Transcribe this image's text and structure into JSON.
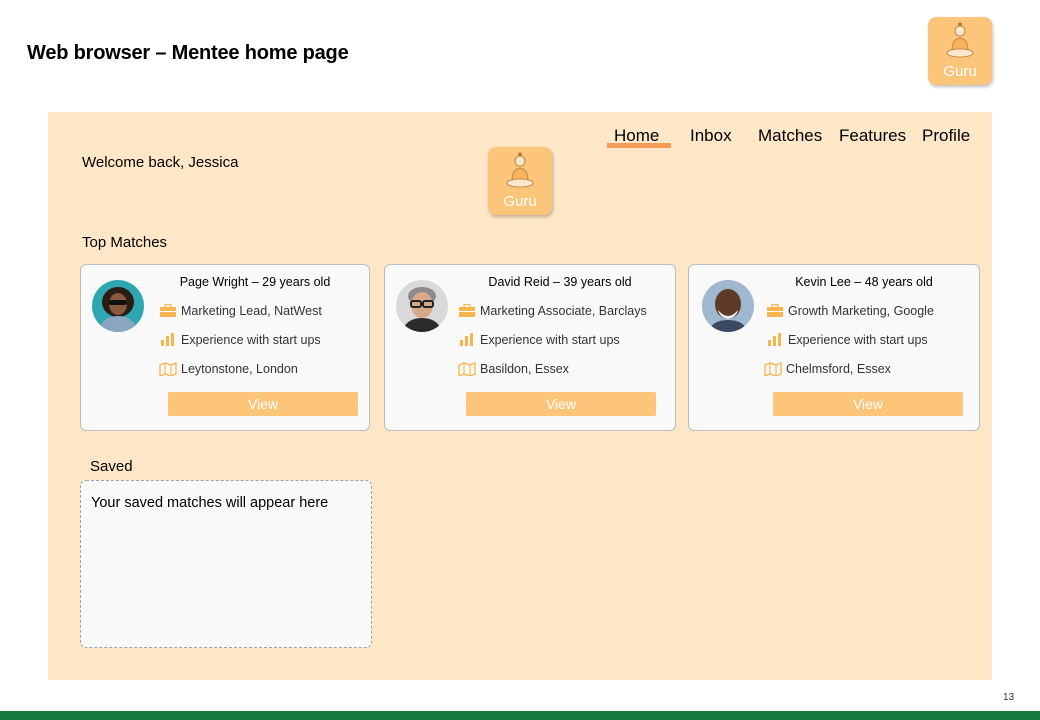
{
  "slide": {
    "title": "Web browser – Mentee home page",
    "page_number": "13",
    "footer_color": "#167a3e"
  },
  "brand": {
    "logo_text": "Guru",
    "logo_icon": "meditating-guru-icon",
    "logo_color": "#fcc57a"
  },
  "nav": {
    "items": [
      {
        "label": "Home",
        "active": true
      },
      {
        "label": "Inbox",
        "active": false
      },
      {
        "label": "Matches",
        "active": false
      },
      {
        "label": "Features",
        "active": false
      },
      {
        "label": "Profile",
        "active": false
      }
    ],
    "active_color": "#f29c57"
  },
  "welcome": "Welcome back, Jessica",
  "top_matches": {
    "title": "Top Matches",
    "cards": [
      {
        "name": "Page Wright – 29 years old",
        "role": "Marketing Lead, NatWest",
        "experience": "Experience with start ups",
        "location": "Leytonstone, London",
        "view_label": "View"
      },
      {
        "name": "David Reid – 39 years old",
        "role": "Marketing Associate, Barclays",
        "experience": "Experience with start ups",
        "location": "Basildon, Essex",
        "view_label": "View"
      },
      {
        "name": "Kevin Lee – 48 years old",
        "role": "Growth Marketing, Google",
        "experience": "Experience with start ups",
        "location": "Chelmsford, Essex",
        "view_label": "View"
      }
    ]
  },
  "saved": {
    "title": "Saved",
    "empty_message": "Your saved matches will appear here"
  },
  "colors": {
    "panel_bg": "#fee7c6",
    "button_bg": "#fcc57a",
    "icon_color": "#f6b54e"
  }
}
